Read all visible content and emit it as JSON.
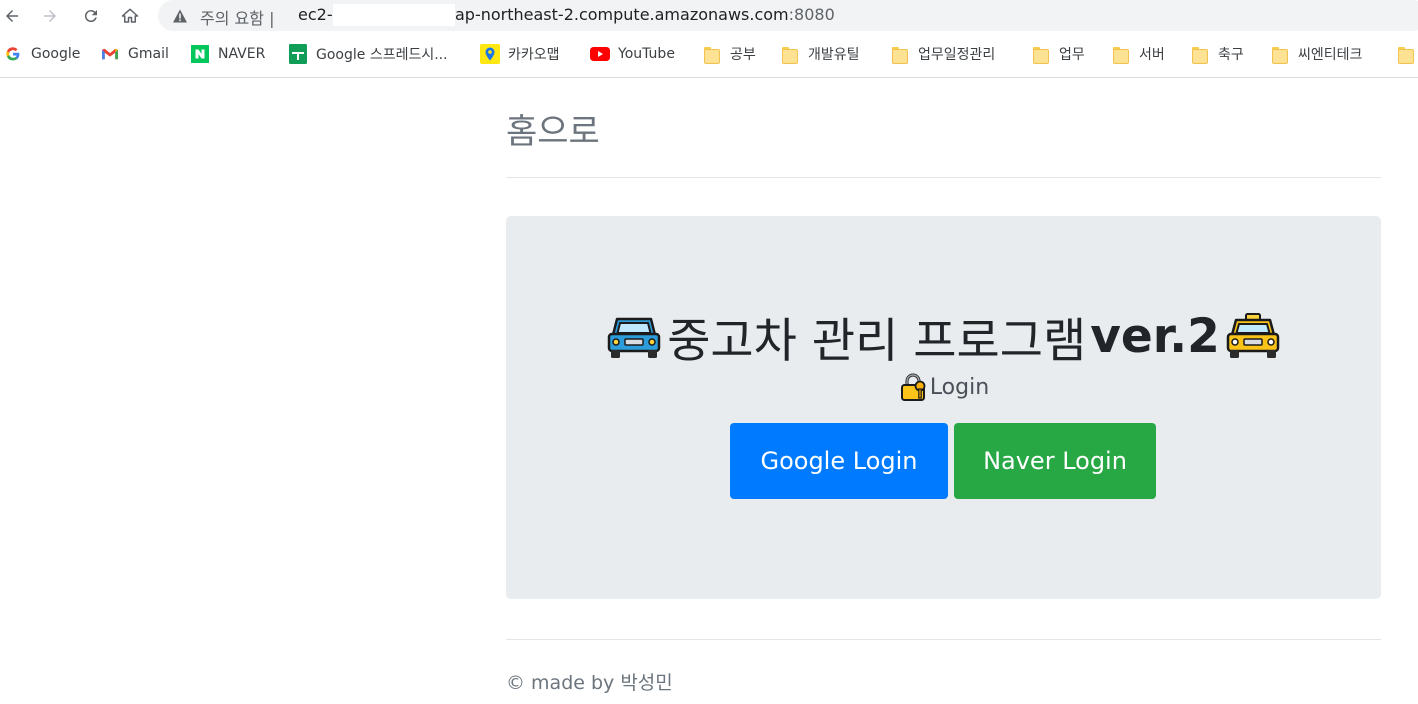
{
  "browser": {
    "address_bar": {
      "warning": "주의 요함",
      "separator": "|",
      "host_prefix": "ec2-",
      "host_suffix": "ap-northeast-2.compute.amazonaws.com",
      "port": ":8080"
    },
    "bookmarks": [
      {
        "label": "Google",
        "icon": "google-icon"
      },
      {
        "label": "Gmail",
        "icon": "gmail-icon"
      },
      {
        "label": "NAVER",
        "icon": "naver-icon"
      },
      {
        "label": "Google 스프레드시...",
        "icon": "sheets-icon"
      },
      {
        "label": "카카오맵",
        "icon": "kakaomap-icon"
      },
      {
        "label": "YouTube",
        "icon": "youtube-icon"
      },
      {
        "label": "공부",
        "icon": "folder-icon"
      },
      {
        "label": "개발유틸",
        "icon": "folder-icon"
      },
      {
        "label": "업무일정관리",
        "icon": "folder-icon"
      },
      {
        "label": "업무",
        "icon": "folder-icon"
      },
      {
        "label": "서버",
        "icon": "folder-icon"
      },
      {
        "label": "축구",
        "icon": "folder-icon"
      },
      {
        "label": "씨엔티테크",
        "icon": "folder-icon"
      }
    ]
  },
  "page": {
    "home_link": "홈으로",
    "title_main": "중고차 관리 프로그램",
    "title_version": "ver.2",
    "login_label": "Login",
    "google_login": "Google Login",
    "naver_login": "Naver Login",
    "footer": "© made by 박성민"
  },
  "colors": {
    "google_button": "#007bff",
    "naver_button": "#28a745",
    "jumbotron_bg": "#e9ecef"
  }
}
